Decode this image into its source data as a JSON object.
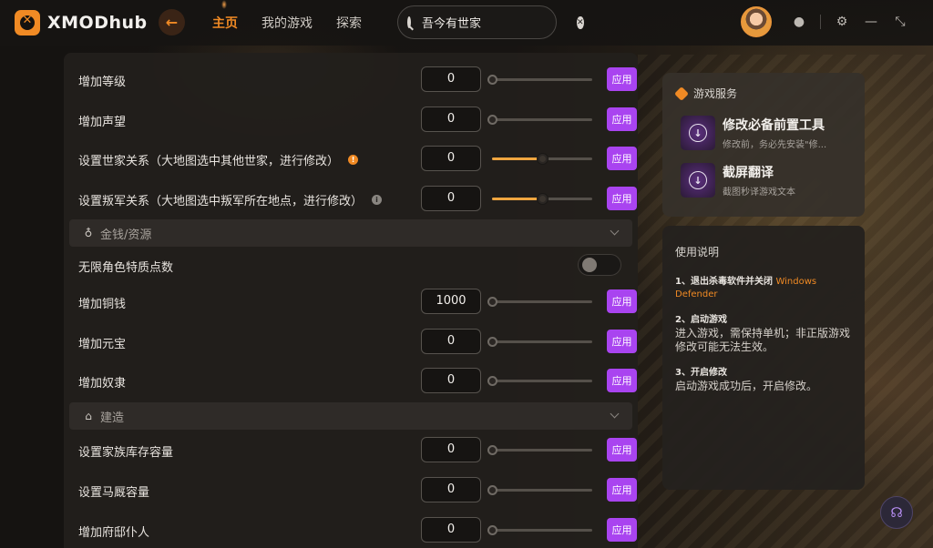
{
  "app": {
    "name": "XMODhub"
  },
  "nav": {
    "home": "主页",
    "my_games": "我的游戏",
    "explore": "探索"
  },
  "search": {
    "value": "吾今有世家"
  },
  "rows_top": [
    {
      "label": "增加等级",
      "value": "0",
      "progress": 0,
      "apply": "应用"
    },
    {
      "label": "增加声望",
      "value": "0",
      "progress": 0,
      "apply": "应用"
    },
    {
      "label": "设置世家关系（大地图选中其他世家，进行修改）",
      "value": "0",
      "progress": 0.5,
      "apply": "应用",
      "info": "orange"
    },
    {
      "label": "设置叛军关系（大地图选中叛军所在地点，进行修改）",
      "value": "0",
      "progress": 0.5,
      "apply": "应用",
      "info": "gray"
    }
  ],
  "section_money": {
    "title": "金钱/资源"
  },
  "toggle_row": {
    "label": "无限角色特质点数",
    "on": false
  },
  "rows_money": [
    {
      "label": "增加铜钱",
      "value": "1000",
      "progress": 0,
      "apply": "应用"
    },
    {
      "label": "增加元宝",
      "value": "0",
      "progress": 0,
      "apply": "应用"
    },
    {
      "label": "增加奴隶",
      "value": "0",
      "progress": 0,
      "apply": "应用"
    }
  ],
  "section_build": {
    "title": "建造"
  },
  "rows_build": [
    {
      "label": "设置家族库存容量",
      "value": "0",
      "progress": 0,
      "apply": "应用"
    },
    {
      "label": "设置马厩容量",
      "value": "0",
      "progress": 0,
      "apply": "应用"
    },
    {
      "label": "增加府邸仆人",
      "value": "0",
      "progress": 0,
      "apply": "应用"
    }
  ],
  "services": {
    "title": "游戏服务",
    "items": [
      {
        "name": "修改必备前置工具",
        "desc": "修改前，务必先安装\"修..."
      },
      {
        "name": "截屏翻译",
        "desc": "截图秒译游戏文本"
      }
    ]
  },
  "guide": {
    "title": "使用说明",
    "step1_title": "1、退出杀毒软件并关闭",
    "step1_highlight": "Windows Defender",
    "step2_title": "2、启动游戏",
    "step2_body": "进入游戏，需保持单机；非正版游戏修改可能无法生效。",
    "step3_title": "3、开启修改",
    "step3_body": "启动游戏成功后，开启修改。"
  },
  "colors": {
    "accent": "#f08a24",
    "apply": "#a944f0",
    "slider": "#f0a640"
  }
}
